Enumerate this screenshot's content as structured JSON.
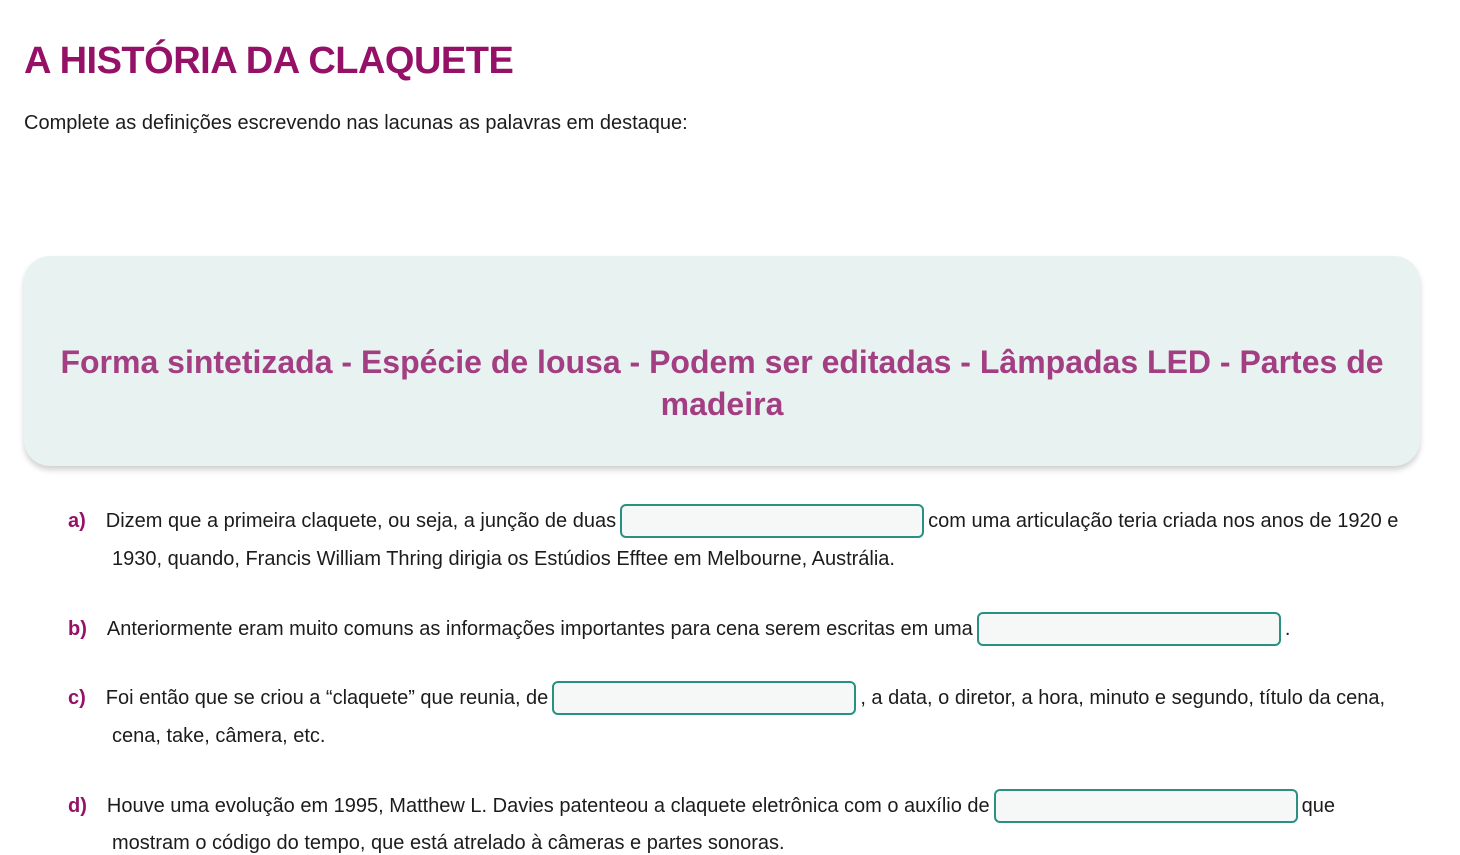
{
  "title": "A HISTÓRIA DA CLAQUETE",
  "instruction": "Complete as definições escrevendo nas lacunas as palavras em destaque:",
  "word_bank": "Forma sintetizada - Espécie de lousa - Podem ser editadas - Lâmpadas LED - Partes de madeira",
  "questions": {
    "a": {
      "letter": "a)",
      "before": "Dizem que a primeira claquete, ou seja, a junção de duas",
      "after": "com uma articulação teria criada nos anos de 1920 e",
      "line2": "1930, quando, Francis William Thring dirigia os Estúdios Efftee em Melbourne, Austrália.",
      "blank_value": ""
    },
    "b": {
      "letter": "b)",
      "before": "Anteriormente eram muito comuns as informações importantes para cena serem escritas em uma",
      "after": ".",
      "blank_value": ""
    },
    "c": {
      "letter": "c)",
      "before": "Foi então que se criou a “claquete” que reunia, de",
      "after": ", a data, o diretor, a hora, minuto e segundo, título da cena,",
      "line2": "cena, take, câmera, etc.",
      "blank_value": ""
    },
    "d": {
      "letter": "d)",
      "before": "Houve uma evolução em 1995, Matthew L. Davies patenteou a claquete eletrônica com o auxílio de",
      "after": "que",
      "line2": "mostram o código do tempo, que está atrelado à câmeras e partes sonoras.",
      "blank_value": ""
    }
  }
}
